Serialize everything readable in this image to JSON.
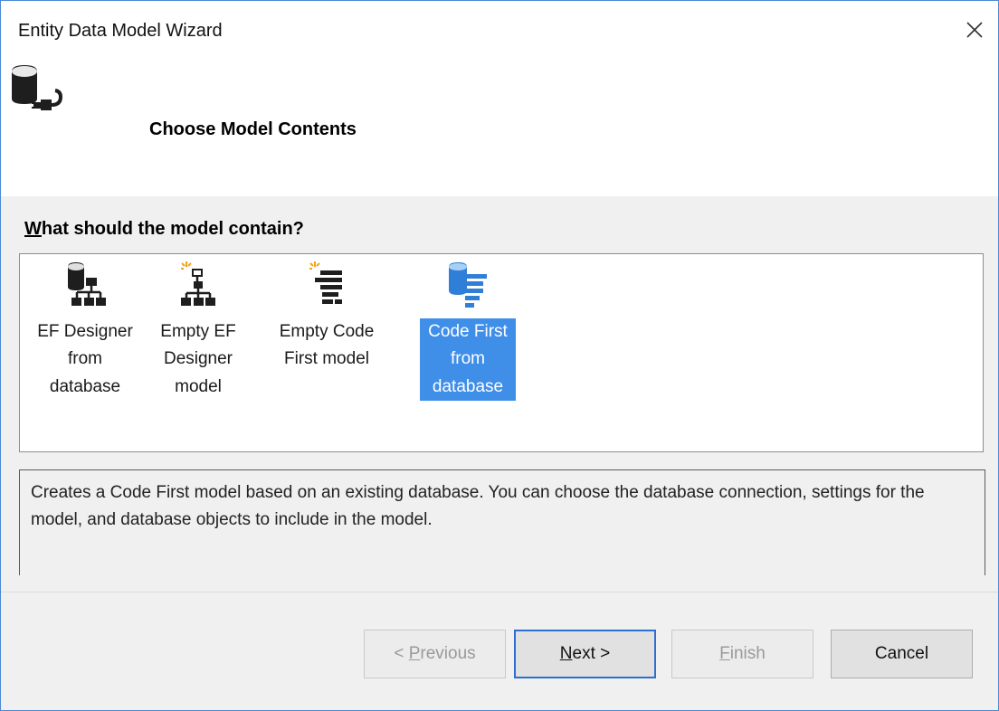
{
  "window": {
    "title": "Entity Data Model Wizard",
    "close_icon": "close-icon",
    "header_icon": "database-plug-icon"
  },
  "page": {
    "heading": "Choose Model Contents"
  },
  "question": {
    "accesskey": "W",
    "rest": "hat should the model contain?"
  },
  "options": [
    {
      "icon": "database-hierarchy-icon",
      "label": "EF Designer\nfrom\ndatabase",
      "selected": false
    },
    {
      "icon": "new-hierarchy-icon",
      "label": "Empty EF\nDesigner\nmodel",
      "selected": false
    },
    {
      "icon": "new-code-icon",
      "label": "Empty Code\nFirst model",
      "selected": false
    },
    {
      "icon": "database-code-icon",
      "label": "Code First\nfrom\ndatabase",
      "selected": true
    }
  ],
  "description": "Creates a Code First model based on an existing database. You can choose the database connection, settings for the model, and database objects to include in the model.",
  "buttons": {
    "previous": {
      "pre": "< ",
      "accesskey": "P",
      "post": "revious",
      "enabled": false
    },
    "next": {
      "accesskey": "N",
      "post": "ext >",
      "enabled": true
    },
    "finish": {
      "accesskey": "F",
      "post": "inish",
      "enabled": false
    },
    "cancel": {
      "label": "Cancel",
      "enabled": true
    }
  },
  "colors": {
    "selection": "#3f8ee8",
    "dialog_border": "#4a8ad6",
    "content_background": "#f0f0f0",
    "default_button_border": "#2d6fd0"
  }
}
